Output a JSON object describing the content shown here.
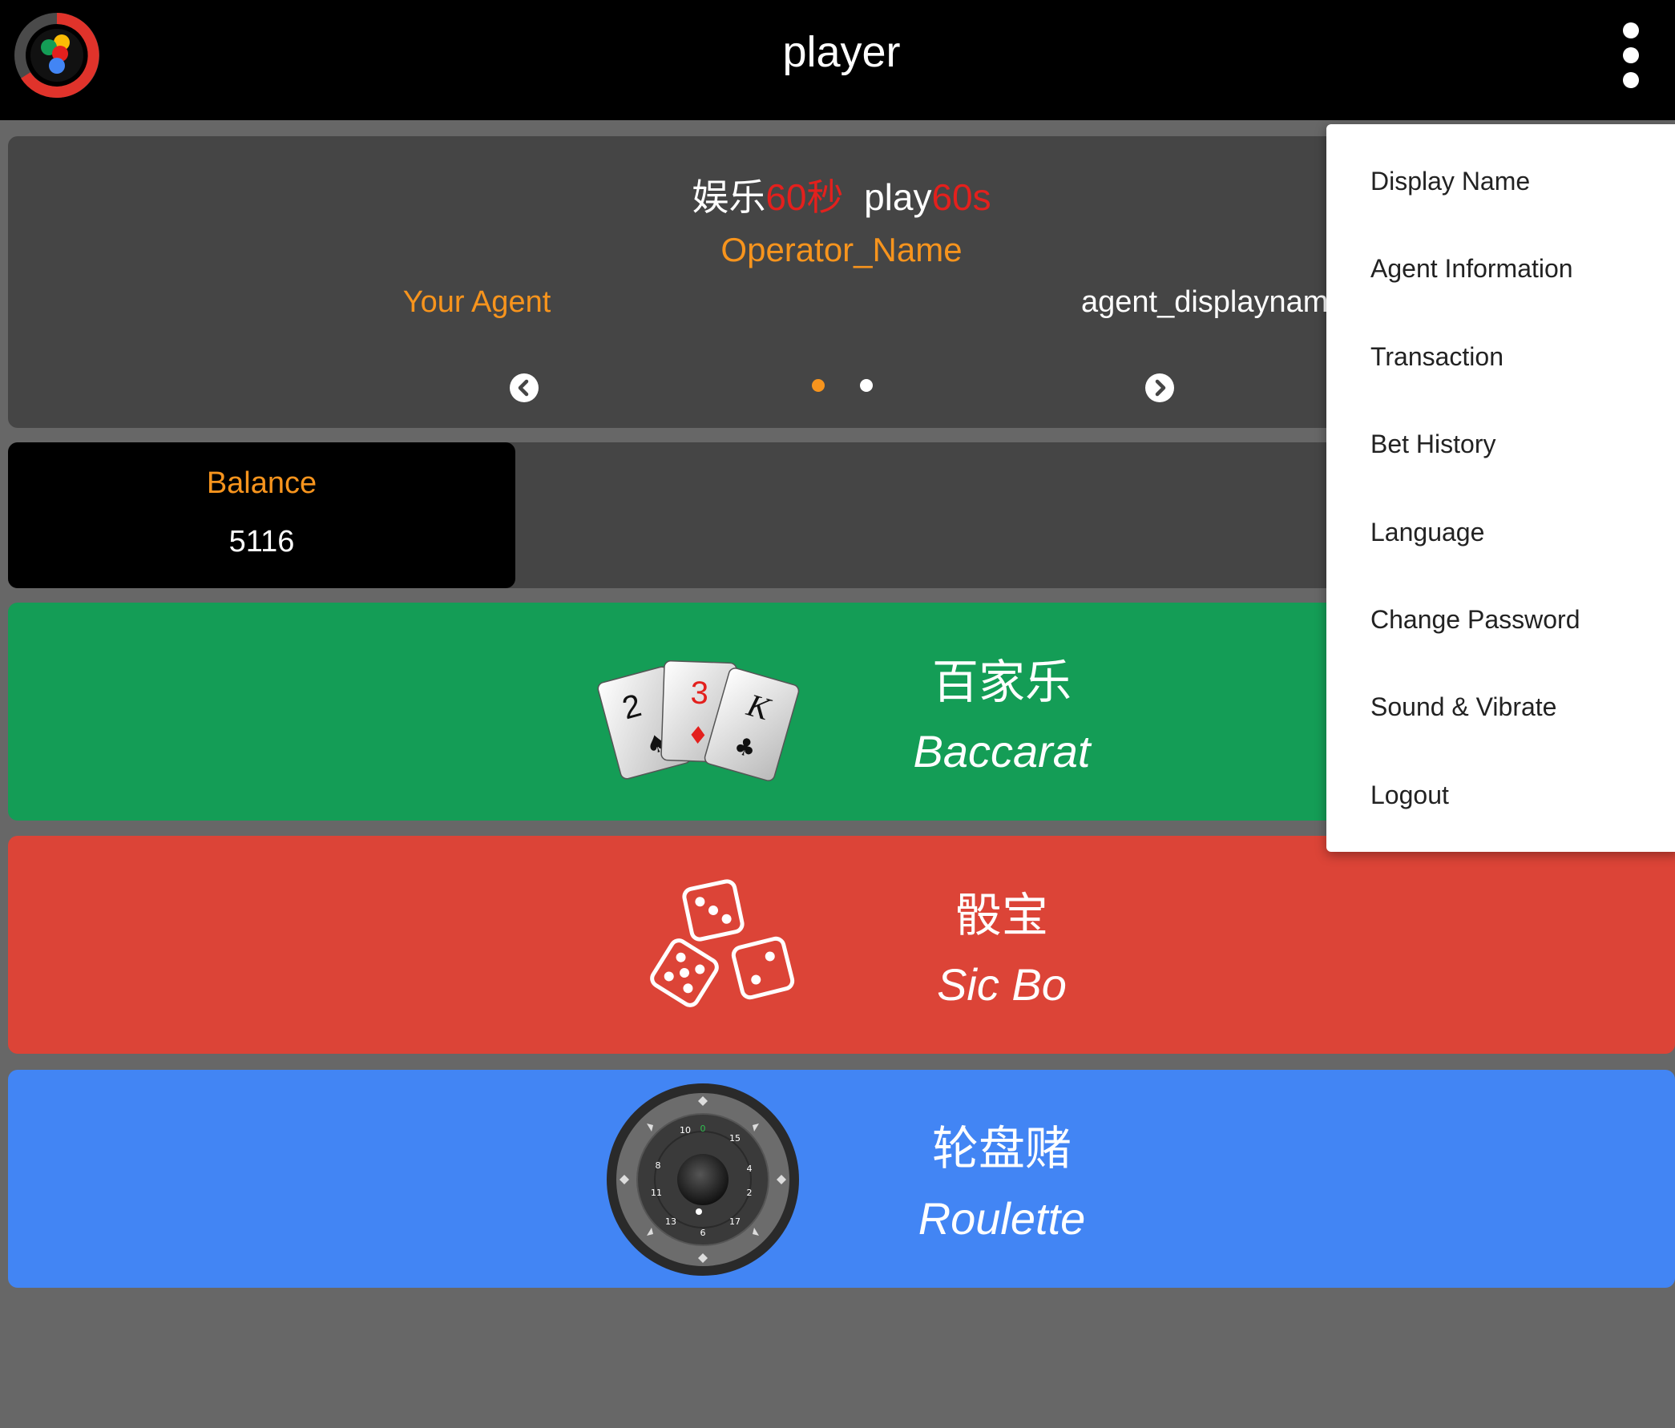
{
  "header": {
    "title": "player"
  },
  "banner": {
    "brand_cn_prefix": "娱乐",
    "brand_cn_accent": "60秒",
    "brand_en_prefix": "play",
    "brand_en_accent": "60s",
    "operator_name": "Operator_Name",
    "agent_label": "Your Agent",
    "agent_value": "agent_displayname",
    "carousel": {
      "slide_count": 2,
      "active_index": 0,
      "active_color": "#f7941d",
      "inactive_color": "#ffffff"
    }
  },
  "balance": {
    "label": "Balance",
    "value": "5116"
  },
  "games": [
    {
      "name_cn": "百家乐",
      "name_en": "Baccarat",
      "color": "#149d56",
      "icon": "playing-cards-icon",
      "cards": [
        "2",
        "3",
        "K"
      ]
    },
    {
      "name_cn": "骰宝",
      "name_en": "Sic Bo",
      "color": "#dc4437",
      "icon": "dice-icon"
    },
    {
      "name_cn": "轮盘赌",
      "name_en": "Roulette",
      "color": "#4285f4",
      "icon": "roulette-wheel-icon",
      "wheel_numbers": [
        "0",
        "15",
        "4",
        "2",
        "17",
        "6",
        "13",
        "11",
        "8",
        "10"
      ]
    }
  ],
  "menu": {
    "items": [
      {
        "label": "Display Name"
      },
      {
        "label": "Agent Information"
      },
      {
        "label": "Transaction"
      },
      {
        "label": "Bet History"
      },
      {
        "label": "Language"
      },
      {
        "label": "Change Password"
      },
      {
        "label": "Sound & Vibrate"
      },
      {
        "label": "Logout"
      }
    ]
  },
  "colors": {
    "orange_accent": "#f7941d",
    "red_accent": "#e3201d",
    "panel_gray": "#454545",
    "background_gray": "#676767"
  }
}
